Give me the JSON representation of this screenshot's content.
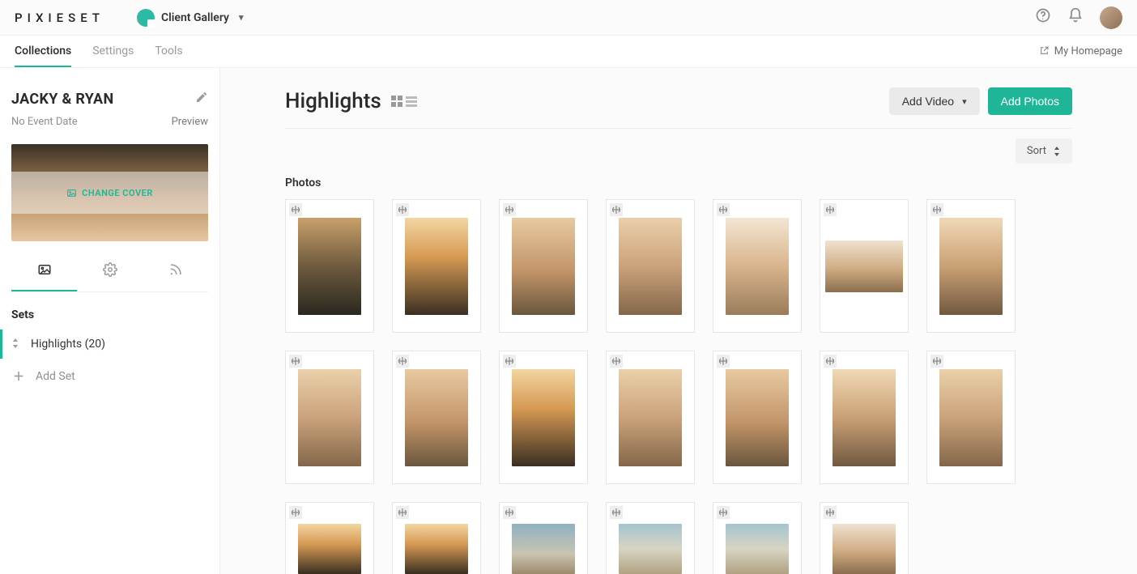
{
  "brand": "PIXIESET",
  "app_switcher": {
    "label": "Client Gallery"
  },
  "top_icons": {
    "help": "help-icon",
    "bell": "bell-icon",
    "avatar": "avatar"
  },
  "nav": {
    "tabs": [
      {
        "label": "Collections",
        "active": true
      },
      {
        "label": "Settings",
        "active": false
      },
      {
        "label": "Tools",
        "active": false
      }
    ],
    "homepage_label": "My Homepage"
  },
  "sidebar": {
    "collection_title": "JACKY & RYAN",
    "event_date": "No Event Date",
    "preview_label": "Preview",
    "change_cover_label": "CHANGE COVER",
    "sets_title": "Sets",
    "sets": [
      {
        "label": "Highlights (20)",
        "active": true
      }
    ],
    "add_set_label": "Add Set"
  },
  "content": {
    "set_title": "Highlights",
    "add_video_label": "Add Video",
    "add_photos_label": "Add Photos",
    "sort_label": "Sort",
    "photos_label": "Photos",
    "photo_count": 20,
    "photos": [
      {
        "id": 1,
        "orientation": "portrait",
        "tone": "g1"
      },
      {
        "id": 2,
        "orientation": "portrait",
        "tone": "g2"
      },
      {
        "id": 3,
        "orientation": "portrait",
        "tone": "g3"
      },
      {
        "id": 4,
        "orientation": "portrait",
        "tone": "g4"
      },
      {
        "id": 5,
        "orientation": "portrait",
        "tone": "g5"
      },
      {
        "id": 6,
        "orientation": "landscape",
        "tone": "g6"
      },
      {
        "id": 7,
        "orientation": "portrait",
        "tone": "g7"
      },
      {
        "id": 8,
        "orientation": "portrait",
        "tone": "g4"
      },
      {
        "id": 9,
        "orientation": "portrait",
        "tone": "g3"
      },
      {
        "id": 10,
        "orientation": "portrait",
        "tone": "g2"
      },
      {
        "id": 11,
        "orientation": "portrait",
        "tone": "g4"
      },
      {
        "id": 12,
        "orientation": "portrait",
        "tone": "g3"
      },
      {
        "id": 13,
        "orientation": "portrait",
        "tone": "g7"
      },
      {
        "id": 14,
        "orientation": "portrait",
        "tone": "g4"
      },
      {
        "id": 15,
        "orientation": "cut",
        "tone": "g2"
      },
      {
        "id": 16,
        "orientation": "cut",
        "tone": "g2"
      },
      {
        "id": 17,
        "orientation": "cut",
        "tone": "g8"
      },
      {
        "id": 18,
        "orientation": "cut",
        "tone": "g9"
      },
      {
        "id": 19,
        "orientation": "cut",
        "tone": "g9"
      },
      {
        "id": 20,
        "orientation": "cut",
        "tone": "g6"
      }
    ]
  },
  "colors": {
    "accent": "#1fb597"
  }
}
